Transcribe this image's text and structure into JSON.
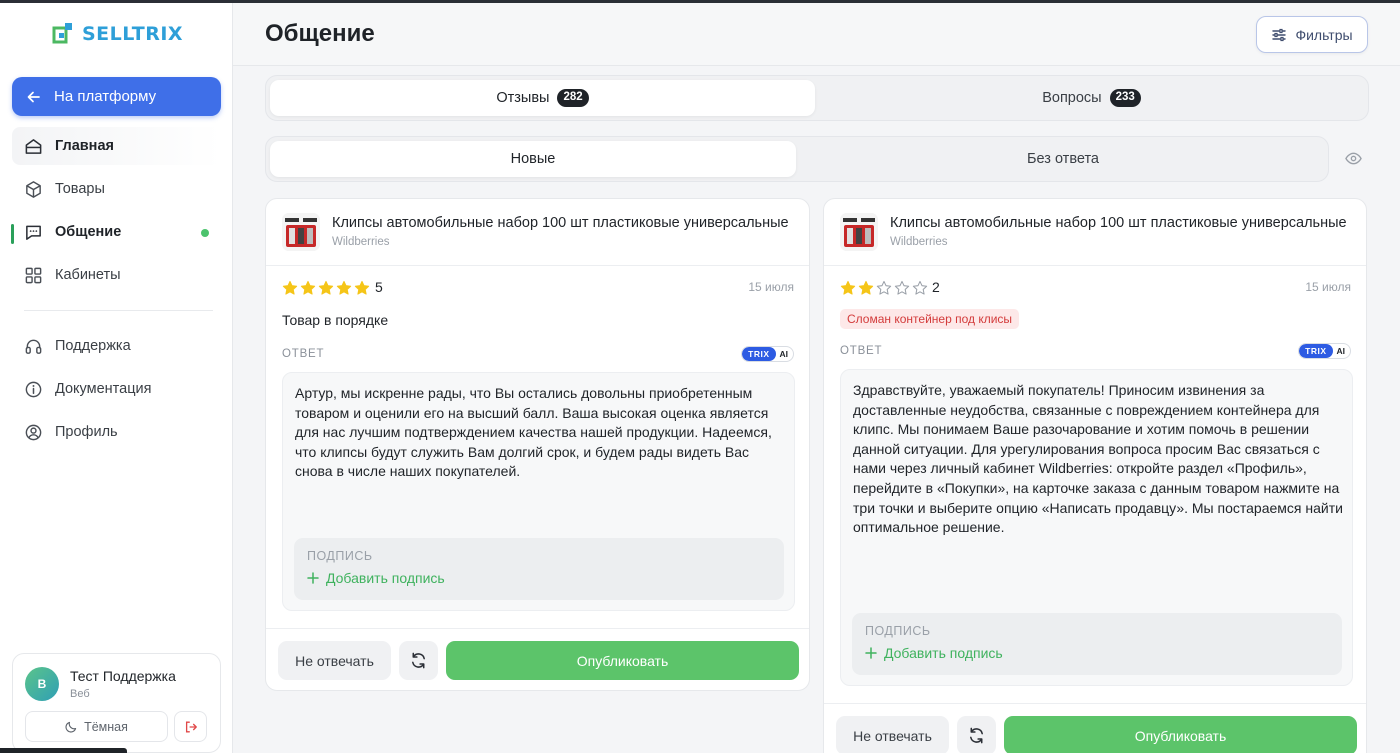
{
  "brand": {
    "name": "SELLTRIX",
    "accent": "#2e9fd8",
    "primary": "#3f6fe8",
    "green": "#5cc46a"
  },
  "sidebar": {
    "back_label": "На платформу",
    "items": [
      {
        "label": "Главная",
        "icon": "home-icon"
      },
      {
        "label": "Товары",
        "icon": "box-icon"
      },
      {
        "label": "Общение",
        "icon": "chat-icon"
      },
      {
        "label": "Кабинеты",
        "icon": "grid-icon"
      },
      {
        "label": "Поддержка",
        "icon": "headset-icon"
      },
      {
        "label": "Документация",
        "icon": "info-icon"
      },
      {
        "label": "Профиль",
        "icon": "user-icon"
      }
    ],
    "user": {
      "initial": "В",
      "name": "Тест Поддержка",
      "sub": "Веб",
      "theme_label": "Тёмная"
    }
  },
  "header": {
    "title": "Общение",
    "filters_label": "Фильтры"
  },
  "tabs": [
    {
      "label": "Отзывы",
      "count": "282"
    },
    {
      "label": "Вопросы",
      "count": "233"
    }
  ],
  "subtabs": [
    {
      "label": "Новые"
    },
    {
      "label": "Без ответа"
    }
  ],
  "reviews": [
    {
      "product": "Клипсы автомобильные набор 100 шт пластиковые универсальные",
      "marketplace": "Wildberries",
      "rating": 5,
      "rating_text": "5",
      "date": "15 июля",
      "text": "Товар в порядке",
      "answer_label": "ОТВЕТ",
      "ai_badge": {
        "trix": "TRIX",
        "ai": "AI"
      },
      "answer": "Артур, мы искренне рады, что Вы остались довольны приобретенным товаром и оценили его на высший балл. Ваша высокая оценка является для нас лучшим подтверждением качества нашей продукции. Надеемся, что клипсы будут служить Вам долгий срок, и будем рады видеть Вас снова в числе наших покупателей.",
      "signature_label": "ПОДПИСЬ",
      "add_signature": "Добавить подпись",
      "skip_label": "Не отвечать",
      "publish_label": "Опубликовать"
    },
    {
      "product": "Клипсы автомобильные набор 100 шт пластиковые универсальные",
      "marketplace": "Wildberries",
      "rating": 2,
      "rating_text": "2",
      "date": "15 июля",
      "tag": "Сломан контейнер под клисы",
      "answer_label": "ОТВЕТ",
      "ai_badge": {
        "trix": "TRIX",
        "ai": "AI"
      },
      "answer": "Здравствуйте, уважаемый покупатель! Приносим извинения за доставленные неудобства, связанные с повреждением контейнера для клипс. Мы понимаем Ваше разочарование и хотим помочь в решении данной ситуации. Для урегулирования вопроса просим Вас связаться с нами через личный кабинет Wildberries: откройте раздел «Профиль», перейдите в «Покупки», на карточке заказа с данным товаром нажмите на три точки и выберите опцию «Написать продавцу». Мы постараемся найти оптимальное решение.",
      "signature_label": "ПОДПИСЬ",
      "add_signature": "Добавить подпись",
      "skip_label": "Не отвечать",
      "publish_label": "Опубликовать"
    }
  ]
}
